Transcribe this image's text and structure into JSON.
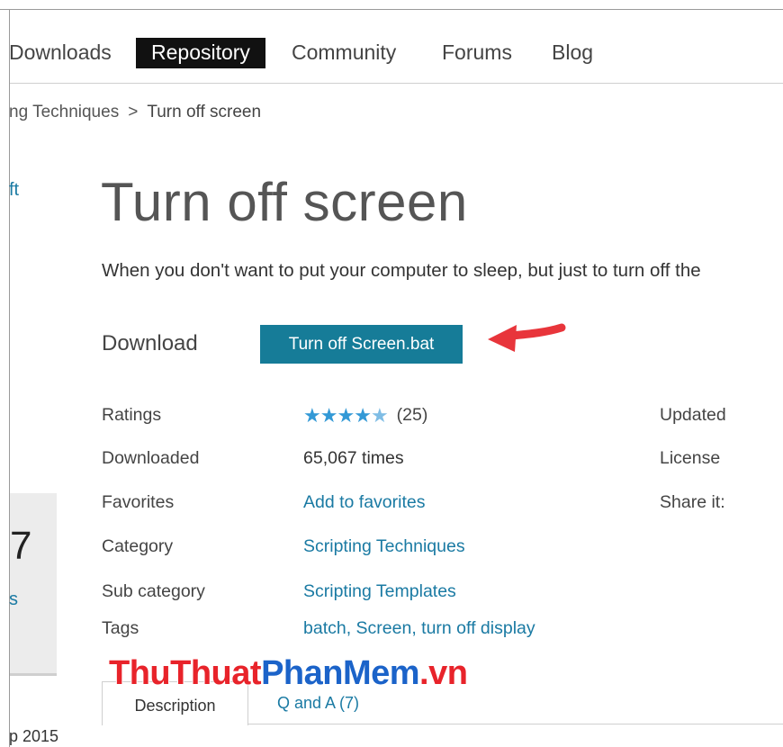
{
  "nav": {
    "items": [
      {
        "label": "Downloads",
        "active": false
      },
      {
        "label": "Repository",
        "active": true
      },
      {
        "label": "Community",
        "active": false
      },
      {
        "label": "Forums",
        "active": false
      },
      {
        "label": "Blog",
        "active": false
      }
    ]
  },
  "breadcrumb": {
    "parent": "ng Techniques",
    "separator": ">",
    "current": "Turn off screen"
  },
  "sidebar": {
    "link_fragment": "ft",
    "box_number": "7",
    "box_link_fragment": "s",
    "date_fragment": "p 2015"
  },
  "page": {
    "title": "Turn off screen",
    "description": "When you don't want to put your computer to sleep, but just to turn off the"
  },
  "download": {
    "label": "Download",
    "button_label": "Turn off Screen.bat",
    "button_color": "#167c98",
    "arrow_color": "#e8353b"
  },
  "details": {
    "ratings_label": "Ratings",
    "ratings_stars": 5,
    "ratings_count": "(25)",
    "downloaded_label": "Downloaded",
    "downloaded_value": "65,067 times",
    "favorites_label": "Favorites",
    "favorites_value": "Add to favorites",
    "category_label": "Category",
    "category_value": "Scripting Techniques",
    "subcategory_label": "Sub category",
    "subcategory_value": "Scripting Templates",
    "tags_label": "Tags",
    "tags_value": "batch, Screen, turn off display",
    "updated_label": "Updated",
    "license_label": "License",
    "share_label": "Share it:"
  },
  "watermark": {
    "part1": "ThuThuat",
    "part2": "PhanMem",
    "part3": ".vn"
  },
  "tabs": [
    {
      "label": "Description",
      "active": true
    },
    {
      "label": "Q and A (7)",
      "active": false
    }
  ],
  "colors": {
    "link": "#1a7aa3",
    "star": "#3399d6"
  }
}
